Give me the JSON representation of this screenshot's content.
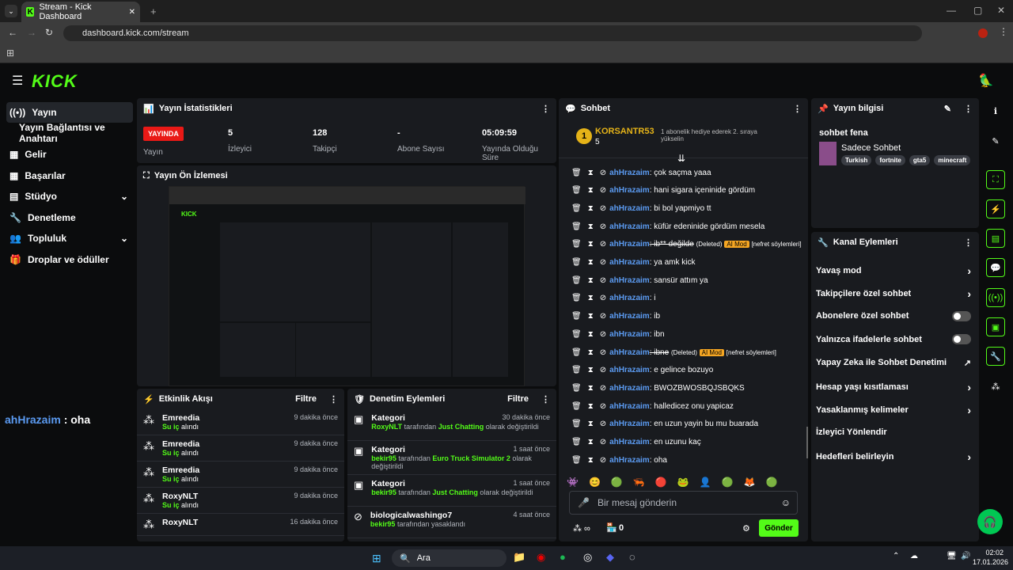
{
  "browser": {
    "tab_title": "Stream - Kick Dashboard",
    "url": "dashboard.kick.com/stream"
  },
  "sidebar": {
    "items": [
      {
        "label": "Yayın",
        "active": true
      },
      {
        "label": "Yayın Bağlantısı ve Anahtarı"
      },
      {
        "label": "Gelir"
      },
      {
        "label": "Başarılar"
      },
      {
        "label": "Stüdyo"
      },
      {
        "label": "Denetleme"
      },
      {
        "label": "Topluluk"
      },
      {
        "label": "Droplar ve ödüller"
      }
    ]
  },
  "stats": {
    "title": "Yayın İstatistikleri",
    "live": "YAYINDA",
    "cells": [
      {
        "value": "",
        "label": "Yayın"
      },
      {
        "value": "5",
        "label": "İzleyici"
      },
      {
        "value": "128",
        "label": "Takipçi"
      },
      {
        "value": "-",
        "label": "Abone Sayısı"
      },
      {
        "value": "05:09:59",
        "label": "Yayında Olduğu Süre"
      }
    ]
  },
  "preview": {
    "title": "Yayın Ön İzlemesi"
  },
  "overlay": {
    "user": "ahHrazaim",
    "text": " : oha"
  },
  "activity": {
    "title": "Etkinlik Akışı",
    "filter": "Filtre",
    "events": [
      {
        "name": "Emreedia",
        "action": "Su iç",
        "suffix": "alındı",
        "time": "9 dakika önce"
      },
      {
        "name": "Emreedia",
        "action": "Su iç",
        "suffix": "alındı",
        "time": "9 dakika önce"
      },
      {
        "name": "Emreedia",
        "action": "Su iç",
        "suffix": "alındı",
        "time": "9 dakika önce"
      },
      {
        "name": "RoxyNLT",
        "action": "Su iç",
        "suffix": "alındı",
        "time": "9 dakika önce"
      },
      {
        "name": "RoxyNLT",
        "action": "",
        "suffix": "",
        "time": "16 dakika önce"
      }
    ]
  },
  "moderation": {
    "title": "Denetim Eylemleri",
    "filter": "Filtre",
    "items": [
      {
        "title": "Kategori",
        "time": "30 dakika önce",
        "who": "RoxyNLT",
        "mid": " tarafından ",
        "target": "Just Chatting",
        "end": " olarak değiştirildi"
      },
      {
        "title": "Kategori",
        "time": "1 saat önce",
        "who": "bekir95",
        "mid": " tarafından ",
        "target": "Euro Truck Simulator 2",
        "end": " olarak değiştirildi"
      },
      {
        "title": "Kategori",
        "time": "1 saat önce",
        "who": "bekir95",
        "mid": " tarafından ",
        "target": "Just Chatting",
        "end": " olarak değiştirildi"
      },
      {
        "title": "biologicalwashingo7",
        "time": "4 saat önce",
        "who": "bekir95",
        "mid": " tarafından yasaklandı",
        "target": "",
        "end": ""
      }
    ]
  },
  "chat": {
    "title": "Sohbet",
    "pinned_user": "KORSANTR53",
    "pinned_rank": "1",
    "pinned_count": "5",
    "pinned_msg": "1 abonelik hediye ederek 2. sıraya yükselin",
    "messages": [
      {
        "user": "ahHrazaim",
        "text": ": çok saçma yaaa"
      },
      {
        "user": "ahHrazaim",
        "text": ": hani sigara içeninide gördüm"
      },
      {
        "user": "ahHrazaim",
        "text": ": bi bol yapmiyo tt"
      },
      {
        "user": "ahHrazaim",
        "text": ": küfür edeninide gördüm mesela"
      },
      {
        "user": "ahHrazaim",
        "text": ": ib** değilde",
        "deleted": "(Deleted)",
        "ai": "AI Mod",
        "reason": "[nefret söylemleri]"
      },
      {
        "user": "ahHrazaim",
        "text": ": ya amk kick"
      },
      {
        "user": "ahHrazaim",
        "text": ": sansür attım ya"
      },
      {
        "user": "ahHrazaim",
        "text": ": i"
      },
      {
        "user": "ahHrazaim",
        "text": ": ib"
      },
      {
        "user": "ahHrazaim",
        "text": ": ibn"
      },
      {
        "user": "ahHrazaim",
        "text": ": ibne",
        "deleted": "(Deleted)",
        "ai": "AI Mod",
        "reason": "[nefret söylemleri]"
      },
      {
        "user": "ahHrazaim",
        "text": ": e gelince bozuyo"
      },
      {
        "user": "ahHrazaim",
        "text": ": BWOZBWOSBQJSBQKS"
      },
      {
        "user": "ahHrazaim",
        "text": ": halledicez onu yapicaz"
      },
      {
        "user": "ahHrazaim",
        "text": ": en uzun yayin bu mu buarada"
      },
      {
        "user": "ahHrazaim",
        "text": ": en uzunu kaç"
      },
      {
        "user": "ahHrazaim",
        "text": ": oha"
      }
    ],
    "placeholder": "Bir mesaj gönderin",
    "points": "0",
    "send": "Gönder"
  },
  "info": {
    "title": "Yayın bilgisi",
    "stream_title": "sohbet fena",
    "category": "Sadece Sohbet",
    "tags": [
      "Turkish",
      "fortnite",
      "gta5",
      "minecraft"
    ]
  },
  "channel": {
    "title": "Kanal Eylemleri",
    "actions": [
      {
        "label": "Yavaş mod",
        "kind": "arrow"
      },
      {
        "label": "Takipçilere özel sohbet",
        "kind": "arrow"
      },
      {
        "label": "Abonelere özel sohbet",
        "kind": "toggle"
      },
      {
        "label": "Yalnızca ifadelerle sohbet",
        "kind": "toggle"
      },
      {
        "label": "Yapay Zeka ile Sohbet Denetimi",
        "kind": "ext"
      },
      {
        "label": "Hesap yaşı kısıtlaması",
        "kind": "arrow"
      },
      {
        "label": "Yasaklanmış kelimeler",
        "kind": "arrow"
      },
      {
        "label": "İzleyici Yönlendir",
        "kind": "none"
      },
      {
        "label": "Hedefleri belirleyin",
        "kind": "arrow"
      }
    ]
  },
  "taskbar": {
    "search": "Ara",
    "time": "02:02",
    "date": "17.01.2026"
  }
}
